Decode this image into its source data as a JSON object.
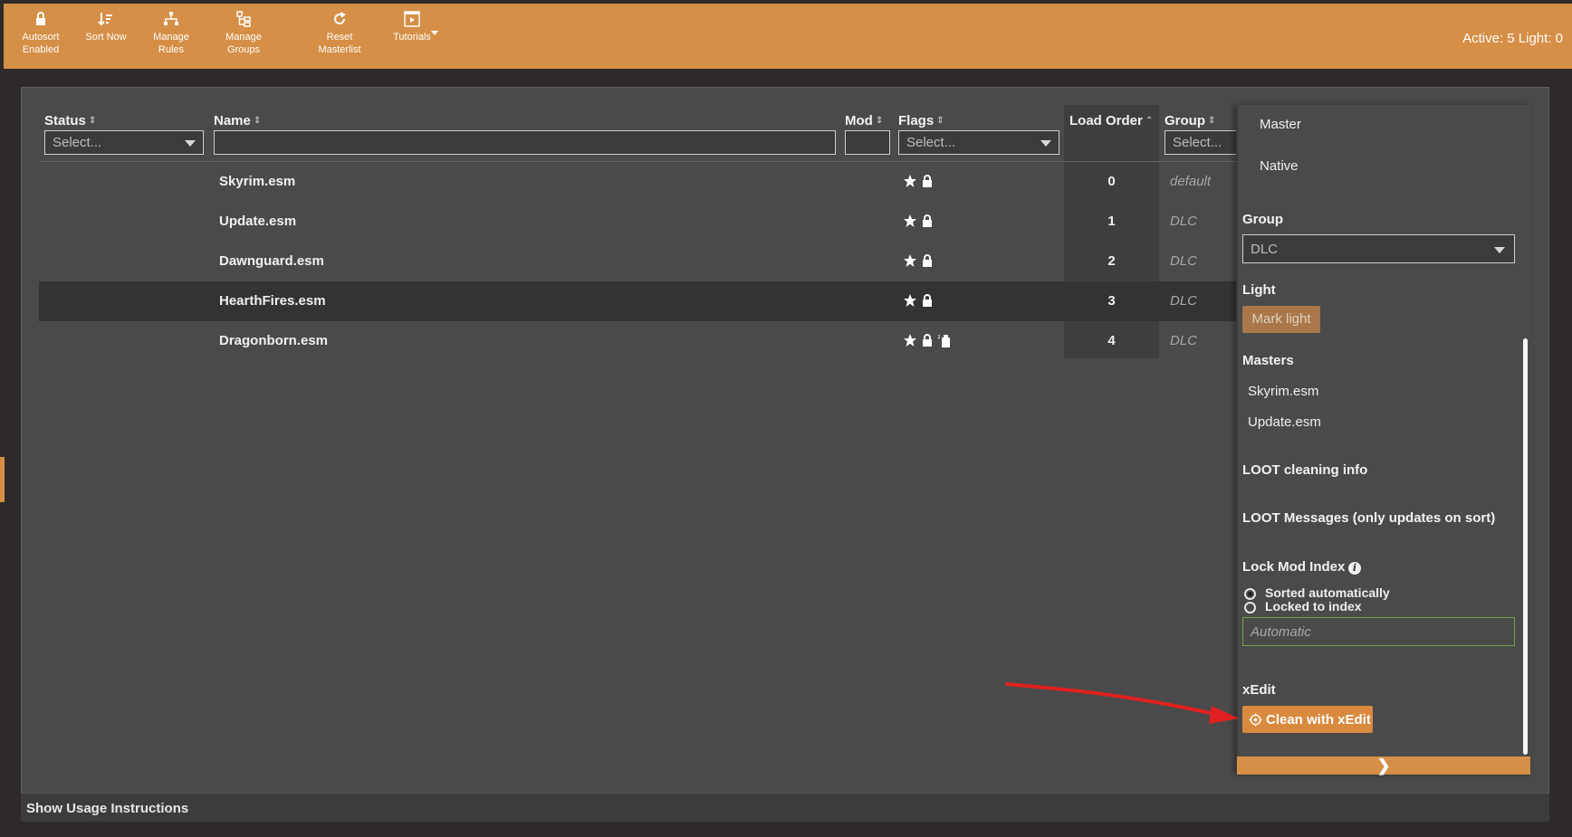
{
  "toolbar": {
    "buttons": [
      {
        "label": "Autosort\nEnabled",
        "icon": "lock-icon"
      },
      {
        "label": "Sort Now",
        "icon": "sort-icon"
      },
      {
        "label": "Manage\nRules",
        "icon": "hierarchy-icon"
      },
      {
        "label": "Manage\nGroups",
        "icon": "groups-icon"
      },
      {
        "label": "Reset\nMasterlist",
        "icon": "refresh-icon"
      },
      {
        "label": "Tutorials",
        "icon": "video-icon"
      }
    ],
    "status": "Active: 5 Light: 0"
  },
  "table": {
    "columns": {
      "status": "Status",
      "name": "Name",
      "mod": "Mod",
      "flags": "Flags",
      "load_order": "Load Order",
      "group": "Group"
    },
    "filters": {
      "status_placeholder": "Select...",
      "flags_placeholder": "Select...",
      "group_placeholder": "Select..."
    },
    "rows": [
      {
        "name": "Skyrim.esm",
        "load_order": "0",
        "group": "default"
      },
      {
        "name": "Update.esm",
        "load_order": "1",
        "group": "DLC"
      },
      {
        "name": "Dawnguard.esm",
        "load_order": "2",
        "group": "DLC"
      },
      {
        "name": "HearthFires.esm",
        "load_order": "3",
        "group": "DLC"
      },
      {
        "name": "Dragonborn.esm",
        "load_order": "4",
        "group": "DLC"
      }
    ]
  },
  "side_card": {
    "flag_master": "Master",
    "flag_native": "Native",
    "group_label": "Group",
    "group_value": "DLC",
    "light_label": "Light",
    "mark_light": "Mark light",
    "masters_label": "Masters",
    "masters": [
      "Skyrim.esm",
      "Update.esm"
    ],
    "cleaning_info": "LOOT cleaning info",
    "messages": "LOOT Messages (only updates on sort)",
    "lock_index_label": "Lock Mod Index",
    "radio_sorted": "Sorted automatically",
    "radio_locked": "Locked to index",
    "index_placeholder": "Automatic",
    "xedit_label": "xEdit",
    "clean_button": "Clean with xEdit",
    "collapse_glyph": "❯"
  },
  "footer": {
    "usage": "Show Usage Instructions"
  },
  "colors": {
    "accent": "#d58f46",
    "panel": "#4a4a4a",
    "annotation": "#e02020"
  }
}
